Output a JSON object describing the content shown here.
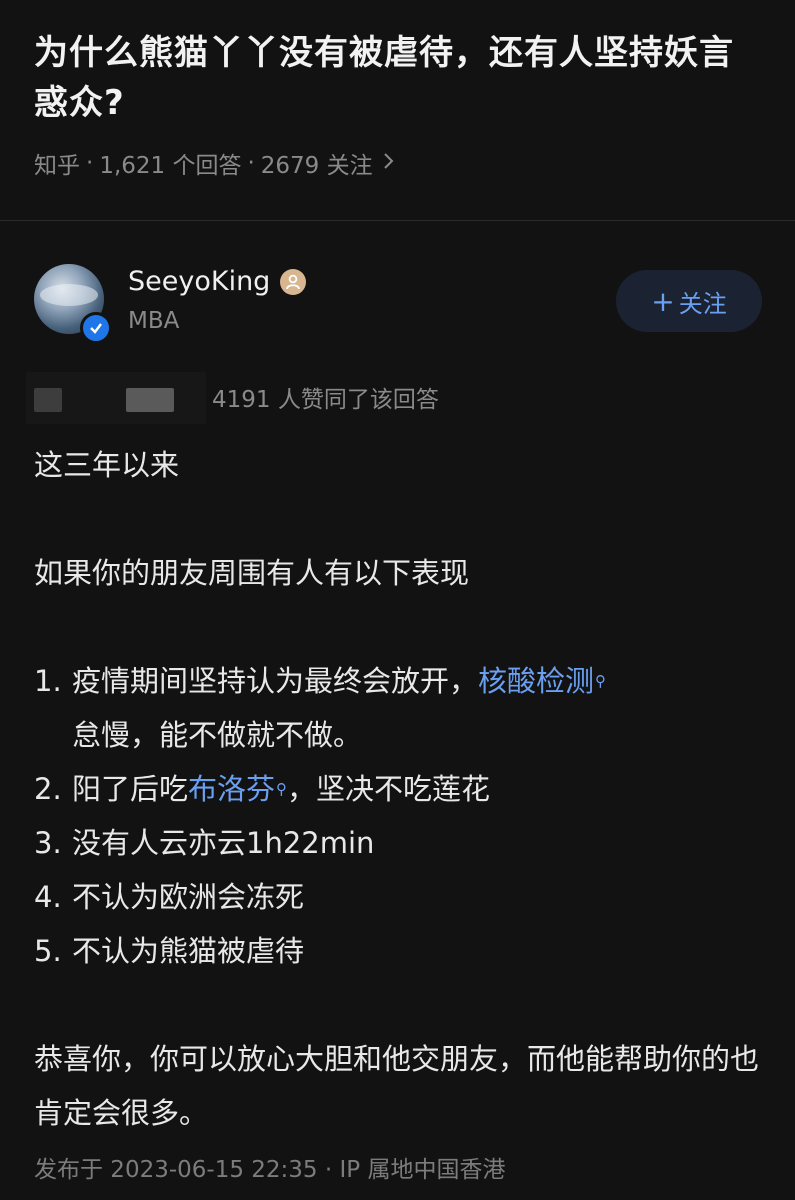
{
  "question": {
    "title": "为什么熊猫丫丫没有被虐待，还有人坚持妖言惑众?",
    "source": "知乎",
    "answers_count": "1,621 个回答",
    "followers": "2679 关注"
  },
  "author": {
    "name": "SeeyoKing",
    "bio": "MBA",
    "follow_label": "关注"
  },
  "vote_text": "4191 人赞同了该回答",
  "answer": {
    "p1": "这三年以来",
    "p2": "如果你的朋友周围有人有以下表现",
    "items": [
      {
        "num": "1.",
        "before": "疫情期间坚持认为最终会放开，",
        "link": "核酸检测",
        "after": "怠慢，能不做就不做。"
      },
      {
        "num": "2.",
        "before": "阳了后吃",
        "link": "布洛芬",
        "after": "，坚决不吃莲花"
      },
      {
        "num": "3.",
        "text": "没有人云亦云1h22min"
      },
      {
        "num": "4.",
        "text": "不认为欧洲会冻死"
      },
      {
        "num": "5.",
        "text": "不认为熊猫被虐待"
      }
    ],
    "p3": "恭喜你，你可以放心大胆和他交朋友，而他能帮助你的也肯定会很多。"
  },
  "publish": "发布于 2023-06-15 22:35 · IP 属地中国香港",
  "colors": {
    "background": "#121212",
    "link": "#6b9ff0",
    "muted": "#8a8a8a",
    "verified": "#1f76e8"
  }
}
